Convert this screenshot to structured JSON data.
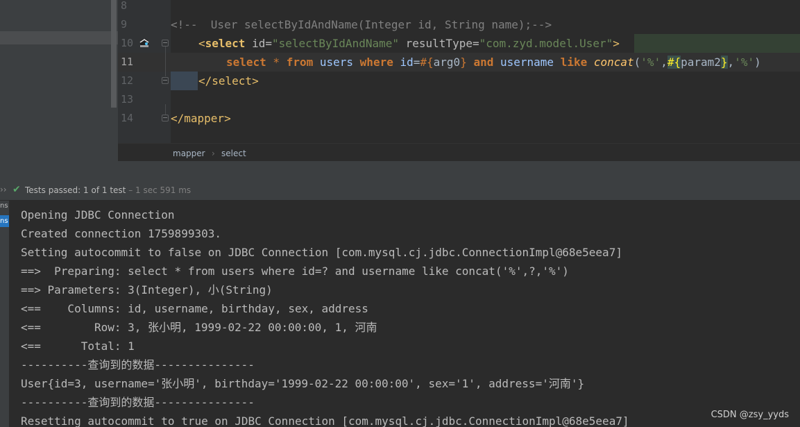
{
  "editor": {
    "gutter_numbers": [
      "8",
      "9",
      "10",
      "11",
      "12",
      "13",
      "14"
    ],
    "line9": {
      "comment": "<!--  User selectByIdAndName(Integer id, String name);-->"
    },
    "line10": {
      "open": "<",
      "tag": "select",
      "attr1": " id=",
      "val1": "\"selectByIdAndName\"",
      "attr2": " resultType=",
      "val2": "\"com.zyd.model.User\"",
      "close": ">"
    },
    "line11": {
      "kw_select": "select",
      "star": " * ",
      "kw_from": "from",
      "table": " users ",
      "kw_where": "where",
      "col_id": " id",
      "eq": "=",
      "p1_open": "#{",
      "p1_name": "arg0",
      "p1_close": "}",
      "kw_and": " and ",
      "col_username": "username",
      "kw_like": " like ",
      "fn": "concat",
      "lparen": "(",
      "s1": "'%'",
      "comma1": ",",
      "p2_open": "#{",
      "p2_name": "param2",
      "p2_close": "}",
      "comma2": ",",
      "s2": "'%'",
      "rparen": ")"
    },
    "line12": {
      "text": "</select>"
    },
    "line14": {
      "text": "</mapper>"
    }
  },
  "breadcrumb": {
    "items": [
      "mapper",
      "select"
    ],
    "separator": "›"
  },
  "run_status": {
    "check_icon": "check-icon",
    "label": "Tests passed:",
    "count": "1",
    "of_text": " of 1 test",
    "time": " – 1 sec 591 ms"
  },
  "console_side": {
    "tab1": "ns",
    "tab2": "ns"
  },
  "console": {
    "lines": [
      "Opening JDBC Connection",
      "Created connection 1759899303.",
      "Setting autocommit to false on JDBC Connection [com.mysql.cj.jdbc.ConnectionImpl@68e5eea7]",
      "==>  Preparing: select * from users where id=? and username like concat('%',?,'%')",
      "==> Parameters: 3(Integer), 小(String)",
      "<==    Columns: id, username, birthday, sex, address",
      "<==        Row: 3, 张小明, 1999-02-22 00:00:00, 1, 河南",
      "<==      Total: 1",
      "----------查询到的数据---------------",
      "User{id=3, username='张小明', birthday='1999-02-22 00:00:00', sex='1', address='河南'}",
      "----------查询到的数据---------------",
      "Resetting autocommit to true on JDBC Connection [com.mysql.cj.jdbc.ConnectionImpl@68e5eea7]"
    ]
  },
  "watermark": "CSDN @zsy_yyds"
}
